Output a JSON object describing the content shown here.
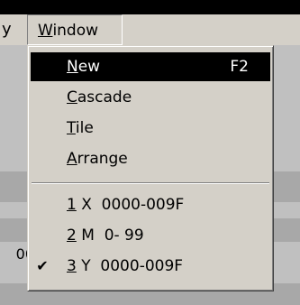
{
  "menubar": {
    "cut_label": "y",
    "window_menu": {
      "accel": "W",
      "rest": "indow"
    }
  },
  "background": {
    "left_text": "00"
  },
  "menu": {
    "items": [
      {
        "accel": "N",
        "rest": "ew",
        "shortcut": "F2",
        "selected": true
      },
      {
        "accel": "C",
        "rest": "ascade",
        "shortcut": ""
      },
      {
        "accel": "T",
        "rest": "ile",
        "shortcut": ""
      },
      {
        "accel": "A",
        "rest": "rrange",
        "shortcut": ""
      }
    ],
    "windows": [
      {
        "accel": "1",
        "rest": " X  0000-009F",
        "checked": false
      },
      {
        "accel": "2",
        "rest": " M  0- 99",
        "checked": false
      },
      {
        "accel": "3",
        "rest": " Y  0000-009F",
        "checked": true
      }
    ],
    "check_mark": "✔"
  }
}
